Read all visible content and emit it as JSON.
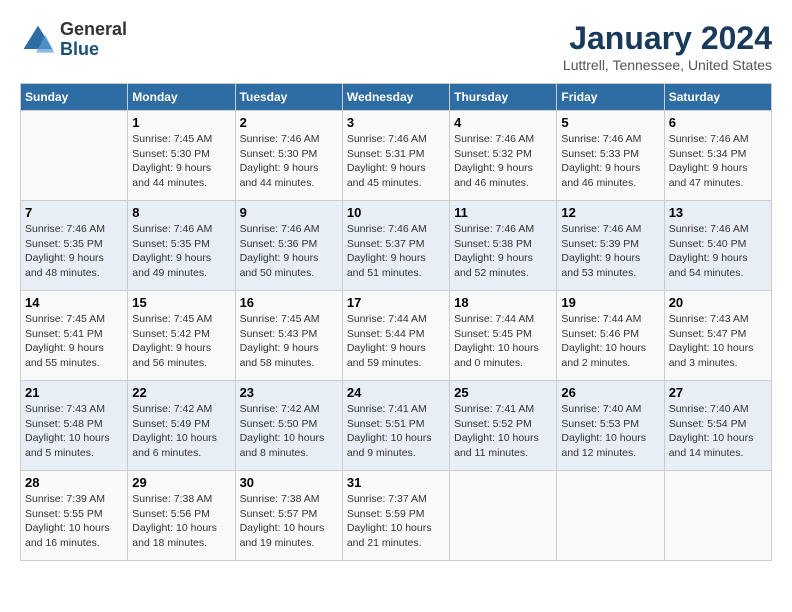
{
  "logo": {
    "general": "General",
    "blue": "Blue"
  },
  "title": "January 2024",
  "location": "Luttrell, Tennessee, United States",
  "days_of_week": [
    "Sunday",
    "Monday",
    "Tuesday",
    "Wednesday",
    "Thursday",
    "Friday",
    "Saturday"
  ],
  "weeks": [
    [
      {
        "day": "",
        "info": ""
      },
      {
        "day": "1",
        "info": "Sunrise: 7:45 AM\nSunset: 5:30 PM\nDaylight: 9 hours\nand 44 minutes."
      },
      {
        "day": "2",
        "info": "Sunrise: 7:46 AM\nSunset: 5:30 PM\nDaylight: 9 hours\nand 44 minutes."
      },
      {
        "day": "3",
        "info": "Sunrise: 7:46 AM\nSunset: 5:31 PM\nDaylight: 9 hours\nand 45 minutes."
      },
      {
        "day": "4",
        "info": "Sunrise: 7:46 AM\nSunset: 5:32 PM\nDaylight: 9 hours\nand 46 minutes."
      },
      {
        "day": "5",
        "info": "Sunrise: 7:46 AM\nSunset: 5:33 PM\nDaylight: 9 hours\nand 46 minutes."
      },
      {
        "day": "6",
        "info": "Sunrise: 7:46 AM\nSunset: 5:34 PM\nDaylight: 9 hours\nand 47 minutes."
      }
    ],
    [
      {
        "day": "7",
        "info": "Sunrise: 7:46 AM\nSunset: 5:35 PM\nDaylight: 9 hours\nand 48 minutes."
      },
      {
        "day": "8",
        "info": "Sunrise: 7:46 AM\nSunset: 5:35 PM\nDaylight: 9 hours\nand 49 minutes."
      },
      {
        "day": "9",
        "info": "Sunrise: 7:46 AM\nSunset: 5:36 PM\nDaylight: 9 hours\nand 50 minutes."
      },
      {
        "day": "10",
        "info": "Sunrise: 7:46 AM\nSunset: 5:37 PM\nDaylight: 9 hours\nand 51 minutes."
      },
      {
        "day": "11",
        "info": "Sunrise: 7:46 AM\nSunset: 5:38 PM\nDaylight: 9 hours\nand 52 minutes."
      },
      {
        "day": "12",
        "info": "Sunrise: 7:46 AM\nSunset: 5:39 PM\nDaylight: 9 hours\nand 53 minutes."
      },
      {
        "day": "13",
        "info": "Sunrise: 7:46 AM\nSunset: 5:40 PM\nDaylight: 9 hours\nand 54 minutes."
      }
    ],
    [
      {
        "day": "14",
        "info": "Sunrise: 7:45 AM\nSunset: 5:41 PM\nDaylight: 9 hours\nand 55 minutes."
      },
      {
        "day": "15",
        "info": "Sunrise: 7:45 AM\nSunset: 5:42 PM\nDaylight: 9 hours\nand 56 minutes."
      },
      {
        "day": "16",
        "info": "Sunrise: 7:45 AM\nSunset: 5:43 PM\nDaylight: 9 hours\nand 58 minutes."
      },
      {
        "day": "17",
        "info": "Sunrise: 7:44 AM\nSunset: 5:44 PM\nDaylight: 9 hours\nand 59 minutes."
      },
      {
        "day": "18",
        "info": "Sunrise: 7:44 AM\nSunset: 5:45 PM\nDaylight: 10 hours\nand 0 minutes."
      },
      {
        "day": "19",
        "info": "Sunrise: 7:44 AM\nSunset: 5:46 PM\nDaylight: 10 hours\nand 2 minutes."
      },
      {
        "day": "20",
        "info": "Sunrise: 7:43 AM\nSunset: 5:47 PM\nDaylight: 10 hours\nand 3 minutes."
      }
    ],
    [
      {
        "day": "21",
        "info": "Sunrise: 7:43 AM\nSunset: 5:48 PM\nDaylight: 10 hours\nand 5 minutes."
      },
      {
        "day": "22",
        "info": "Sunrise: 7:42 AM\nSunset: 5:49 PM\nDaylight: 10 hours\nand 6 minutes."
      },
      {
        "day": "23",
        "info": "Sunrise: 7:42 AM\nSunset: 5:50 PM\nDaylight: 10 hours\nand 8 minutes."
      },
      {
        "day": "24",
        "info": "Sunrise: 7:41 AM\nSunset: 5:51 PM\nDaylight: 10 hours\nand 9 minutes."
      },
      {
        "day": "25",
        "info": "Sunrise: 7:41 AM\nSunset: 5:52 PM\nDaylight: 10 hours\nand 11 minutes."
      },
      {
        "day": "26",
        "info": "Sunrise: 7:40 AM\nSunset: 5:53 PM\nDaylight: 10 hours\nand 12 minutes."
      },
      {
        "day": "27",
        "info": "Sunrise: 7:40 AM\nSunset: 5:54 PM\nDaylight: 10 hours\nand 14 minutes."
      }
    ],
    [
      {
        "day": "28",
        "info": "Sunrise: 7:39 AM\nSunset: 5:55 PM\nDaylight: 10 hours\nand 16 minutes."
      },
      {
        "day": "29",
        "info": "Sunrise: 7:38 AM\nSunset: 5:56 PM\nDaylight: 10 hours\nand 18 minutes."
      },
      {
        "day": "30",
        "info": "Sunrise: 7:38 AM\nSunset: 5:57 PM\nDaylight: 10 hours\nand 19 minutes."
      },
      {
        "day": "31",
        "info": "Sunrise: 7:37 AM\nSunset: 5:59 PM\nDaylight: 10 hours\nand 21 minutes."
      },
      {
        "day": "",
        "info": ""
      },
      {
        "day": "",
        "info": ""
      },
      {
        "day": "",
        "info": ""
      }
    ]
  ]
}
